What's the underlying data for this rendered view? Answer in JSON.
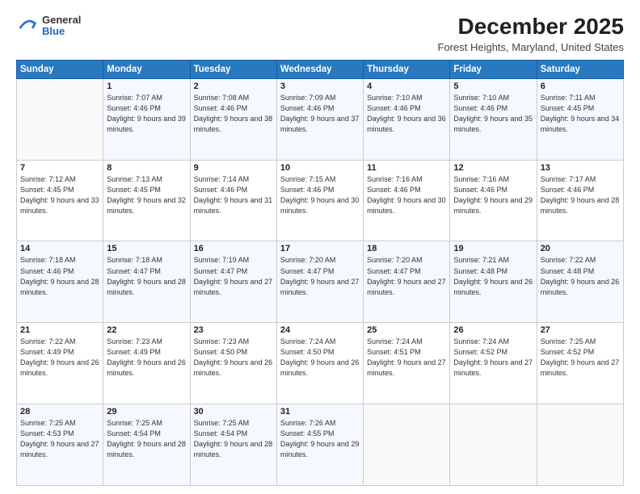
{
  "logo": {
    "general": "General",
    "blue": "Blue"
  },
  "header": {
    "title": "December 2025",
    "subtitle": "Forest Heights, Maryland, United States"
  },
  "weekdays": [
    "Sunday",
    "Monday",
    "Tuesday",
    "Wednesday",
    "Thursday",
    "Friday",
    "Saturday"
  ],
  "weeks": [
    [
      {
        "num": "",
        "empty": true
      },
      {
        "num": "1",
        "sunrise": "7:07 AM",
        "sunset": "4:46 PM",
        "daylight": "9 hours and 39 minutes."
      },
      {
        "num": "2",
        "sunrise": "7:08 AM",
        "sunset": "4:46 PM",
        "daylight": "9 hours and 38 minutes."
      },
      {
        "num": "3",
        "sunrise": "7:09 AM",
        "sunset": "4:46 PM",
        "daylight": "9 hours and 37 minutes."
      },
      {
        "num": "4",
        "sunrise": "7:10 AM",
        "sunset": "4:46 PM",
        "daylight": "9 hours and 36 minutes."
      },
      {
        "num": "5",
        "sunrise": "7:10 AM",
        "sunset": "4:46 PM",
        "daylight": "9 hours and 35 minutes."
      },
      {
        "num": "6",
        "sunrise": "7:11 AM",
        "sunset": "4:45 PM",
        "daylight": "9 hours and 34 minutes."
      }
    ],
    [
      {
        "num": "7",
        "sunrise": "7:12 AM",
        "sunset": "4:45 PM",
        "daylight": "9 hours and 33 minutes."
      },
      {
        "num": "8",
        "sunrise": "7:13 AM",
        "sunset": "4:45 PM",
        "daylight": "9 hours and 32 minutes."
      },
      {
        "num": "9",
        "sunrise": "7:14 AM",
        "sunset": "4:46 PM",
        "daylight": "9 hours and 31 minutes."
      },
      {
        "num": "10",
        "sunrise": "7:15 AM",
        "sunset": "4:46 PM",
        "daylight": "9 hours and 30 minutes."
      },
      {
        "num": "11",
        "sunrise": "7:16 AM",
        "sunset": "4:46 PM",
        "daylight": "9 hours and 30 minutes."
      },
      {
        "num": "12",
        "sunrise": "7:16 AM",
        "sunset": "4:46 PM",
        "daylight": "9 hours and 29 minutes."
      },
      {
        "num": "13",
        "sunrise": "7:17 AM",
        "sunset": "4:46 PM",
        "daylight": "9 hours and 28 minutes."
      }
    ],
    [
      {
        "num": "14",
        "sunrise": "7:18 AM",
        "sunset": "4:46 PM",
        "daylight": "9 hours and 28 minutes."
      },
      {
        "num": "15",
        "sunrise": "7:18 AM",
        "sunset": "4:47 PM",
        "daylight": "9 hours and 28 minutes."
      },
      {
        "num": "16",
        "sunrise": "7:19 AM",
        "sunset": "4:47 PM",
        "daylight": "9 hours and 27 minutes."
      },
      {
        "num": "17",
        "sunrise": "7:20 AM",
        "sunset": "4:47 PM",
        "daylight": "9 hours and 27 minutes."
      },
      {
        "num": "18",
        "sunrise": "7:20 AM",
        "sunset": "4:47 PM",
        "daylight": "9 hours and 27 minutes."
      },
      {
        "num": "19",
        "sunrise": "7:21 AM",
        "sunset": "4:48 PM",
        "daylight": "9 hours and 26 minutes."
      },
      {
        "num": "20",
        "sunrise": "7:22 AM",
        "sunset": "4:48 PM",
        "daylight": "9 hours and 26 minutes."
      }
    ],
    [
      {
        "num": "21",
        "sunrise": "7:22 AM",
        "sunset": "4:49 PM",
        "daylight": "9 hours and 26 minutes."
      },
      {
        "num": "22",
        "sunrise": "7:23 AM",
        "sunset": "4:49 PM",
        "daylight": "9 hours and 26 minutes."
      },
      {
        "num": "23",
        "sunrise": "7:23 AM",
        "sunset": "4:50 PM",
        "daylight": "9 hours and 26 minutes."
      },
      {
        "num": "24",
        "sunrise": "7:24 AM",
        "sunset": "4:50 PM",
        "daylight": "9 hours and 26 minutes."
      },
      {
        "num": "25",
        "sunrise": "7:24 AM",
        "sunset": "4:51 PM",
        "daylight": "9 hours and 27 minutes."
      },
      {
        "num": "26",
        "sunrise": "7:24 AM",
        "sunset": "4:52 PM",
        "daylight": "9 hours and 27 minutes."
      },
      {
        "num": "27",
        "sunrise": "7:25 AM",
        "sunset": "4:52 PM",
        "daylight": "9 hours and 27 minutes."
      }
    ],
    [
      {
        "num": "28",
        "sunrise": "7:25 AM",
        "sunset": "4:53 PM",
        "daylight": "9 hours and 27 minutes."
      },
      {
        "num": "29",
        "sunrise": "7:25 AM",
        "sunset": "4:54 PM",
        "daylight": "9 hours and 28 minutes."
      },
      {
        "num": "30",
        "sunrise": "7:25 AM",
        "sunset": "4:54 PM",
        "daylight": "9 hours and 28 minutes."
      },
      {
        "num": "31",
        "sunrise": "7:26 AM",
        "sunset": "4:55 PM",
        "daylight": "9 hours and 29 minutes."
      },
      {
        "num": "",
        "empty": true
      },
      {
        "num": "",
        "empty": true
      },
      {
        "num": "",
        "empty": true
      }
    ]
  ]
}
